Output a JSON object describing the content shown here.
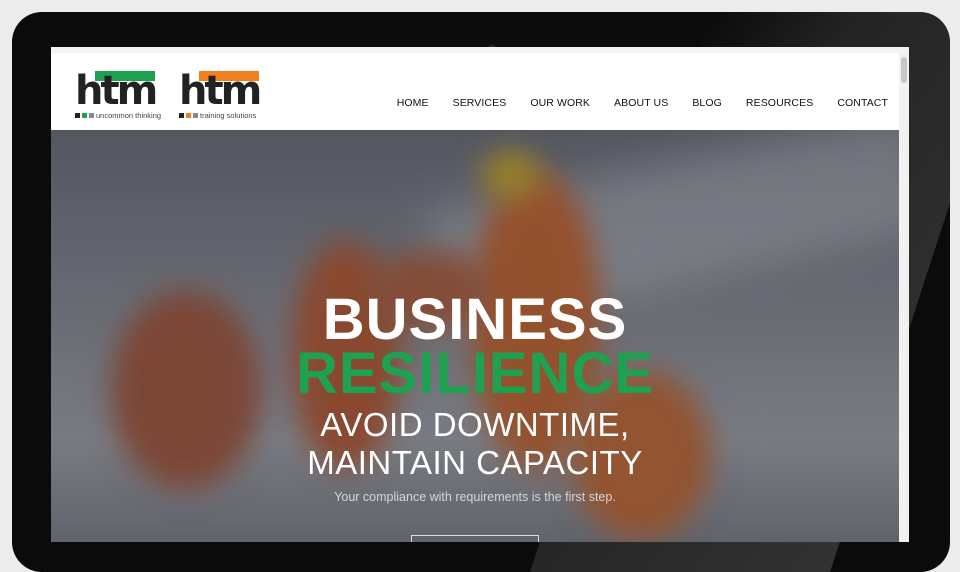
{
  "logos": [
    {
      "wordmark": "htm",
      "tagline": "uncommon thinking",
      "accent": "#1fa152"
    },
    {
      "wordmark": "htm",
      "tagline": "training solutions",
      "accent": "#f07f1c"
    }
  ],
  "nav": {
    "items": [
      "HOME",
      "SERVICES",
      "OUR WORK",
      "ABOUT US",
      "BLOG",
      "RESOURCES",
      "CONTACT"
    ]
  },
  "hero": {
    "line1": "BUSINESS",
    "line2": "RESILIENCE",
    "line3": "AVOID DOWNTIME,",
    "line4": "MAINTAIN CAPACITY",
    "caption": "Your compliance with requirements is the first step.",
    "accent": "#1fa152"
  }
}
